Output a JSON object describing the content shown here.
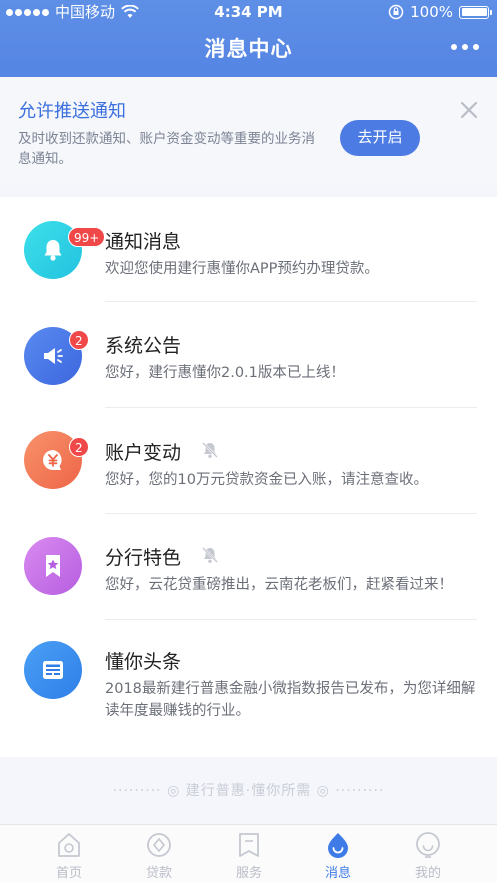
{
  "status_bar": {
    "carrier": "中国移动",
    "time": "4:34 PM",
    "battery": "100%"
  },
  "nav": {
    "title": "消息中心"
  },
  "banner": {
    "title": "允许推送通知",
    "description": "及时收到还款通知、账户资金变动等重要的业务消息通知。",
    "button_label": "去开启"
  },
  "messages": [
    {
      "title": "通知消息",
      "preview": "欢迎您使用建行惠懂你APP预约办理贷款。",
      "badge": "99+",
      "icon": "bell-icon",
      "muted": false,
      "color": "#2fd0e0"
    },
    {
      "title": "系统公告",
      "preview": "您好，建行惠懂你2.0.1版本已上线！",
      "badge": "2",
      "icon": "megaphone-icon",
      "muted": false,
      "color": "#4a78e8"
    },
    {
      "title": "账户变动",
      "preview": "您好，您的10万元贷款资金已入账，请注意查收。",
      "badge": "2",
      "icon": "yuan-coin-icon",
      "muted": true,
      "color": "#f47a5c"
    },
    {
      "title": "分行特色",
      "preview": "您好，云花贷重磅推出，云南花老板们，赶紧看过来！",
      "badge": "",
      "icon": "bookmark-star-icon",
      "muted": true,
      "color": "#c070e6"
    },
    {
      "title": "懂你头条",
      "preview": "2018最新建行普惠金融小微指数报告已发布，为您详细解读年度最赚钱的行业。",
      "badge": "",
      "icon": "newspaper-icon",
      "muted": false,
      "color": "#3a8cf0"
    }
  ],
  "footer": {
    "slogan": "建行普惠·懂你所需"
  },
  "tabs": [
    {
      "label": "首页",
      "icon": "home-icon",
      "active": false
    },
    {
      "label": "贷款",
      "icon": "loan-icon",
      "active": false
    },
    {
      "label": "服务",
      "icon": "service-icon",
      "active": false
    },
    {
      "label": "消息",
      "icon": "message-icon",
      "active": true
    },
    {
      "label": "我的",
      "icon": "profile-icon",
      "active": false
    }
  ],
  "colors": {
    "header": "#5585e3",
    "accent": "#4c7ce3",
    "badge": "#f04848"
  }
}
